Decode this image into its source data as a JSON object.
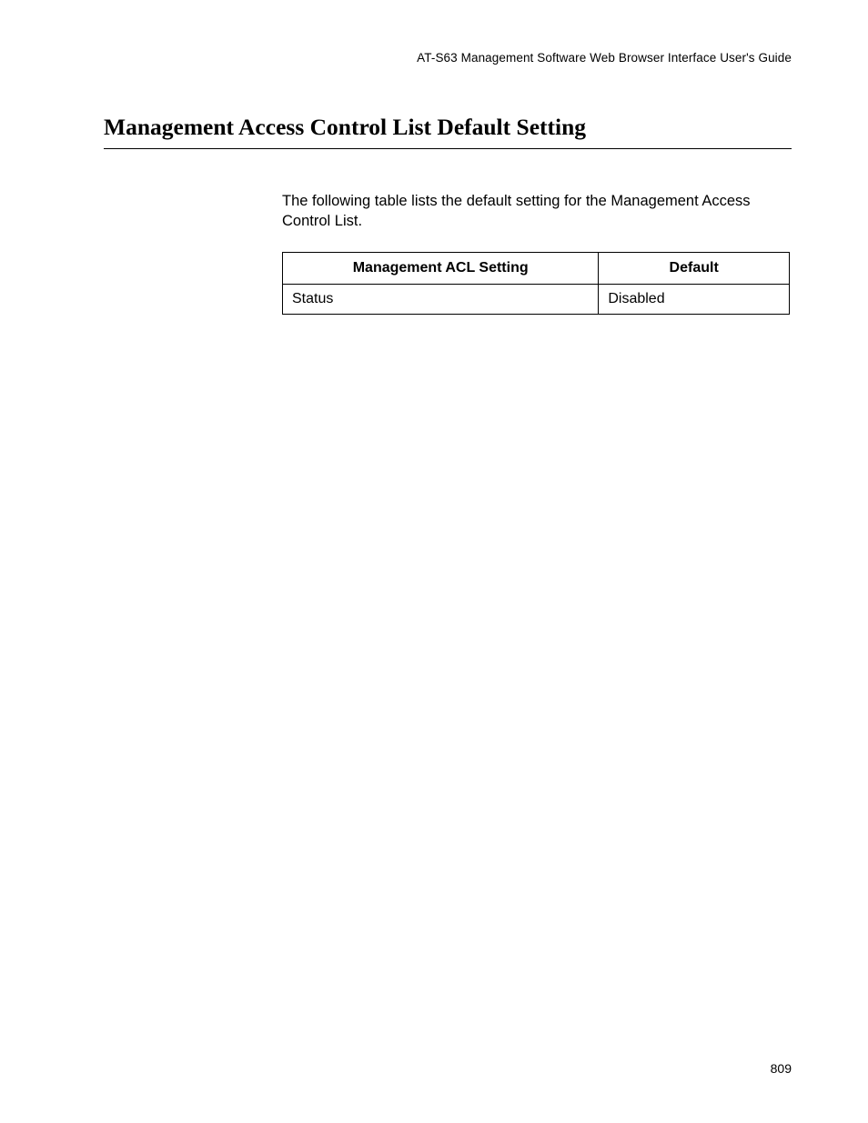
{
  "header": {
    "doc_title": "AT-S63 Management Software Web Browser Interface User's Guide"
  },
  "section": {
    "heading": "Management Access Control List Default Setting",
    "intro": "The following table lists the default setting for the Management Access Control List."
  },
  "table": {
    "headers": {
      "setting": "Management ACL Setting",
      "default": "Default"
    },
    "rows": [
      {
        "setting": "Status",
        "default": "Disabled"
      }
    ]
  },
  "footer": {
    "page_number": "809"
  }
}
